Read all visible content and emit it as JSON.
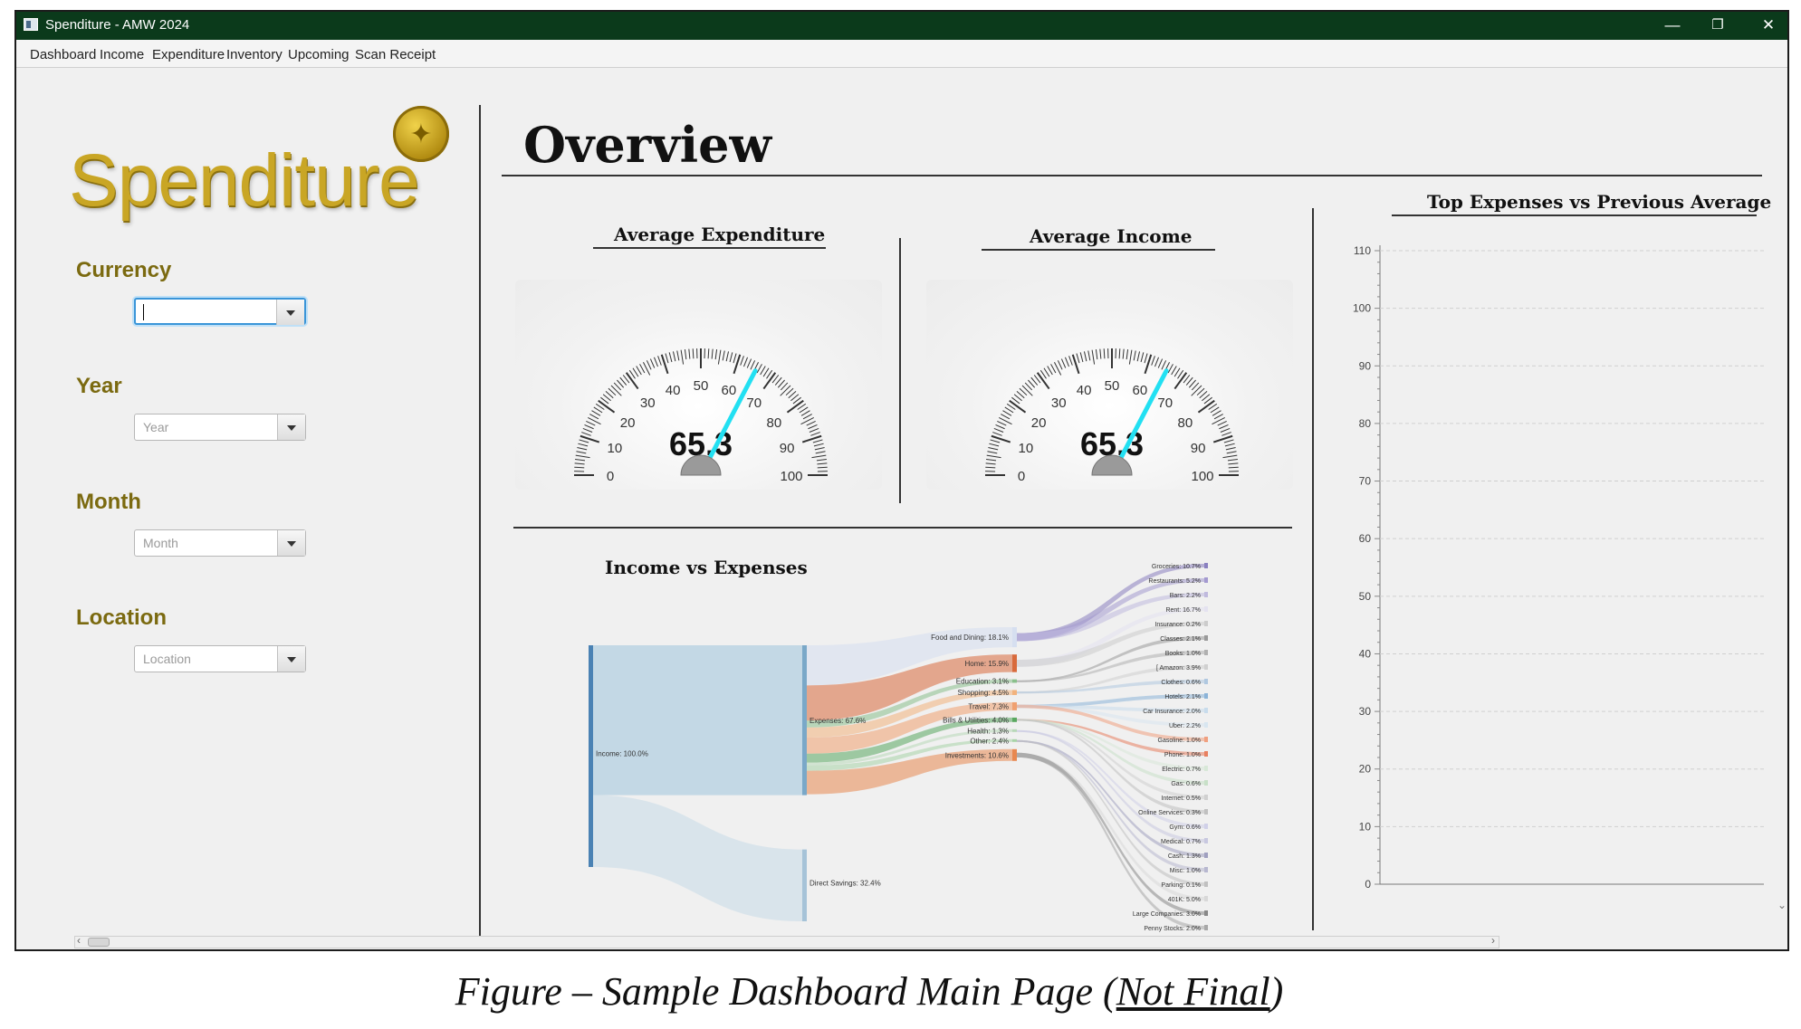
{
  "window": {
    "title": "Spenditure - AMW 2024",
    "controls": {
      "minimize": "—",
      "restore": "❐",
      "close": "✕"
    }
  },
  "menu": [
    "Dashboard",
    "Income",
    "Expenditure",
    "Inventory",
    "Upcoming",
    "Scan Receipt"
  ],
  "sidebar": {
    "logo_text": "Spenditure",
    "filters": [
      {
        "label": "Currency",
        "value": "",
        "placeholder": ""
      },
      {
        "label": "Year",
        "value": "",
        "placeholder": "Year"
      },
      {
        "label": "Month",
        "value": "",
        "placeholder": "Month"
      },
      {
        "label": "Location",
        "value": "",
        "placeholder": "Location"
      }
    ]
  },
  "main": {
    "heading": "Overview",
    "gauges": [
      {
        "title": "Average Expenditure",
        "value": 65.3,
        "display": "65.3",
        "min": 0,
        "max": 100,
        "tick_labels": [
          "0",
          "10",
          "20",
          "30",
          "40",
          "50",
          "60",
          "70",
          "80",
          "90",
          "100"
        ]
      },
      {
        "title": "Average Income",
        "value": 65.3,
        "display": "65.3",
        "min": 0,
        "max": 100,
        "tick_labels": [
          "0",
          "10",
          "20",
          "30",
          "40",
          "50",
          "60",
          "70",
          "80",
          "90",
          "100"
        ]
      }
    ],
    "sankey_title": "Income vs Expenses",
    "bar_chart_title": "Top Expenses vs Previous Average"
  },
  "caption": {
    "prefix": "Figure – Sample Dashboard Main Page (",
    "underlined": "Not Final",
    "suffix": ")"
  },
  "colors": {
    "titlebar": "#0b3a1b",
    "accent_gold": "#c9a625",
    "needle": "#22e0f2"
  },
  "chart_data": [
    {
      "type": "sankey",
      "title": "Income vs Expenses",
      "nodes": [
        {
          "id": "income",
          "label": "Income: 100.0%",
          "value": 100.0,
          "color": "#4a82b4"
        },
        {
          "id": "expenses",
          "label": "Expenses: 67.6%",
          "value": 67.6,
          "color": "#7aa8c8"
        },
        {
          "id": "savings",
          "label": "Direct Savings: 32.4%",
          "value": 32.4,
          "color": "#a6c3d8"
        },
        {
          "id": "food",
          "label": "Food and Dining: 18.1%",
          "value": 18.1,
          "color": "#d6dff0"
        },
        {
          "id": "home",
          "label": "Home: 15.9%",
          "value": 15.9,
          "color": "#d86a3c"
        },
        {
          "id": "education",
          "label": "Education: 3.1%",
          "value": 3.1,
          "color": "#8ac08c"
        },
        {
          "id": "shopping",
          "label": "Shopping: 4.5%",
          "value": 4.5,
          "color": "#f2b27c"
        },
        {
          "id": "travel",
          "label": "Travel: 7.3%",
          "value": 7.3,
          "color": "#f0a070"
        },
        {
          "id": "bills",
          "label": "Bills & Utilities: 4.0%",
          "value": 4.0,
          "color": "#5aa860"
        },
        {
          "id": "health",
          "label": "Health: 1.3%",
          "value": 1.3,
          "color": "#b8d8b8"
        },
        {
          "id": "other",
          "label": "Other: 2.4%",
          "value": 2.4,
          "color": "#a8d4a8"
        },
        {
          "id": "investments",
          "label": "Investments: 10.6%",
          "value": 10.6,
          "color": "#e88850"
        }
      ],
      "leaves": [
        {
          "label": "Groceries: 10.7%",
          "color": "#8a80c0"
        },
        {
          "label": "Restaurants: 5.2%",
          "color": "#a49ad0"
        },
        {
          "label": "Bars: 2.2%",
          "color": "#c0bade"
        },
        {
          "label": "Rent: 16.7%",
          "color": "#e4e2f0"
        },
        {
          "label": "Insurance: 0.2%",
          "color": "#cccccc"
        },
        {
          "label": "Classes: 2.1%",
          "color": "#9a9a9a"
        },
        {
          "label": "Books: 1.0%",
          "color": "#b0b0b0"
        },
        {
          "label": "[ Amazon: 3.9%",
          "color": "#d0d0d0"
        },
        {
          "label": "Clothes: 0.6%",
          "color": "#b0c8e0"
        },
        {
          "label": "Hotels: 2.1%",
          "color": "#8cb4d8"
        },
        {
          "label": "Car Insurance: 2.0%",
          "color": "#c8dcec"
        },
        {
          "label": "Uber: 2.2%",
          "color": "#d8e6f0"
        },
        {
          "label": "Gasoline: 1.0%",
          "color": "#f0a080"
        },
        {
          "label": "Phone: 1.0%",
          "color": "#e88060"
        },
        {
          "label": "Electric: 0.7%",
          "color": "#d8e8d8"
        },
        {
          "label": "Gas: 0.6%",
          "color": "#c8e0c8"
        },
        {
          "label": "Internet: 0.5%",
          "color": "#d0d0d0"
        },
        {
          "label": "Online Services: 0.3%",
          "color": "#c0c0c0"
        },
        {
          "label": "Gym: 0.6%",
          "color": "#d0d0e8"
        },
        {
          "label": "Medical: 0.7%",
          "color": "#c8c8e0"
        },
        {
          "label": "Cash: 1.3%",
          "color": "#a0a0c0"
        },
        {
          "label": "Misc: 1.0%",
          "color": "#b8b8d0"
        },
        {
          "label": "Parking: 0.1%",
          "color": "#c0c0c0"
        },
        {
          "label": "401K: 5.0%",
          "color": "#d8d8d8"
        },
        {
          "label": "Large Companies: 3.0%",
          "color": "#888888"
        },
        {
          "label": "Penny Stocks: 2.0%",
          "color": "#a8a8a8"
        }
      ]
    },
    {
      "type": "bar",
      "title": "Top Expenses vs Previous Average",
      "categories": [],
      "series": [],
      "ylim": [
        0,
        110
      ],
      "yticks": [
        0,
        10,
        20,
        30,
        40,
        50,
        60,
        70,
        80,
        90,
        100,
        110
      ],
      "grid": true
    }
  ]
}
